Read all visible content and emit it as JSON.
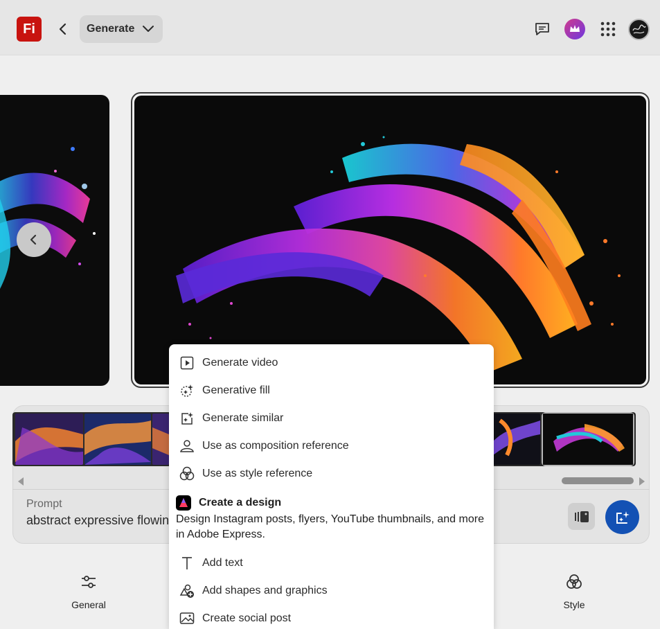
{
  "header": {
    "logo_text": "Fi",
    "mode_label": "Generate"
  },
  "prompt": {
    "label": "Prompt",
    "text": "abstract expressive flowin"
  },
  "menu": {
    "items": [
      {
        "label": "Generate video",
        "icon": "play-icon"
      },
      {
        "label": "Generative fill",
        "icon": "generative-fill-icon"
      },
      {
        "label": "Generate similar",
        "icon": "generate-similar-icon"
      },
      {
        "label": "Use as composition reference",
        "icon": "composition-icon"
      },
      {
        "label": "Use as style reference",
        "icon": "style-icon"
      }
    ],
    "design": {
      "title": "Create a design",
      "description": "Design Instagram posts, flyers, YouTube thumbnails, and more in Adobe Express."
    },
    "express_items": [
      {
        "label": "Add text",
        "icon": "text-icon"
      },
      {
        "label": "Add shapes and graphics",
        "icon": "shapes-icon"
      },
      {
        "label": "Create social post",
        "icon": "image-icon"
      }
    ]
  },
  "bottom_tools": {
    "general": "General",
    "style": "Style"
  },
  "colors": {
    "logo_red": "#c8130f",
    "generate_blue": "#1351b4"
  }
}
